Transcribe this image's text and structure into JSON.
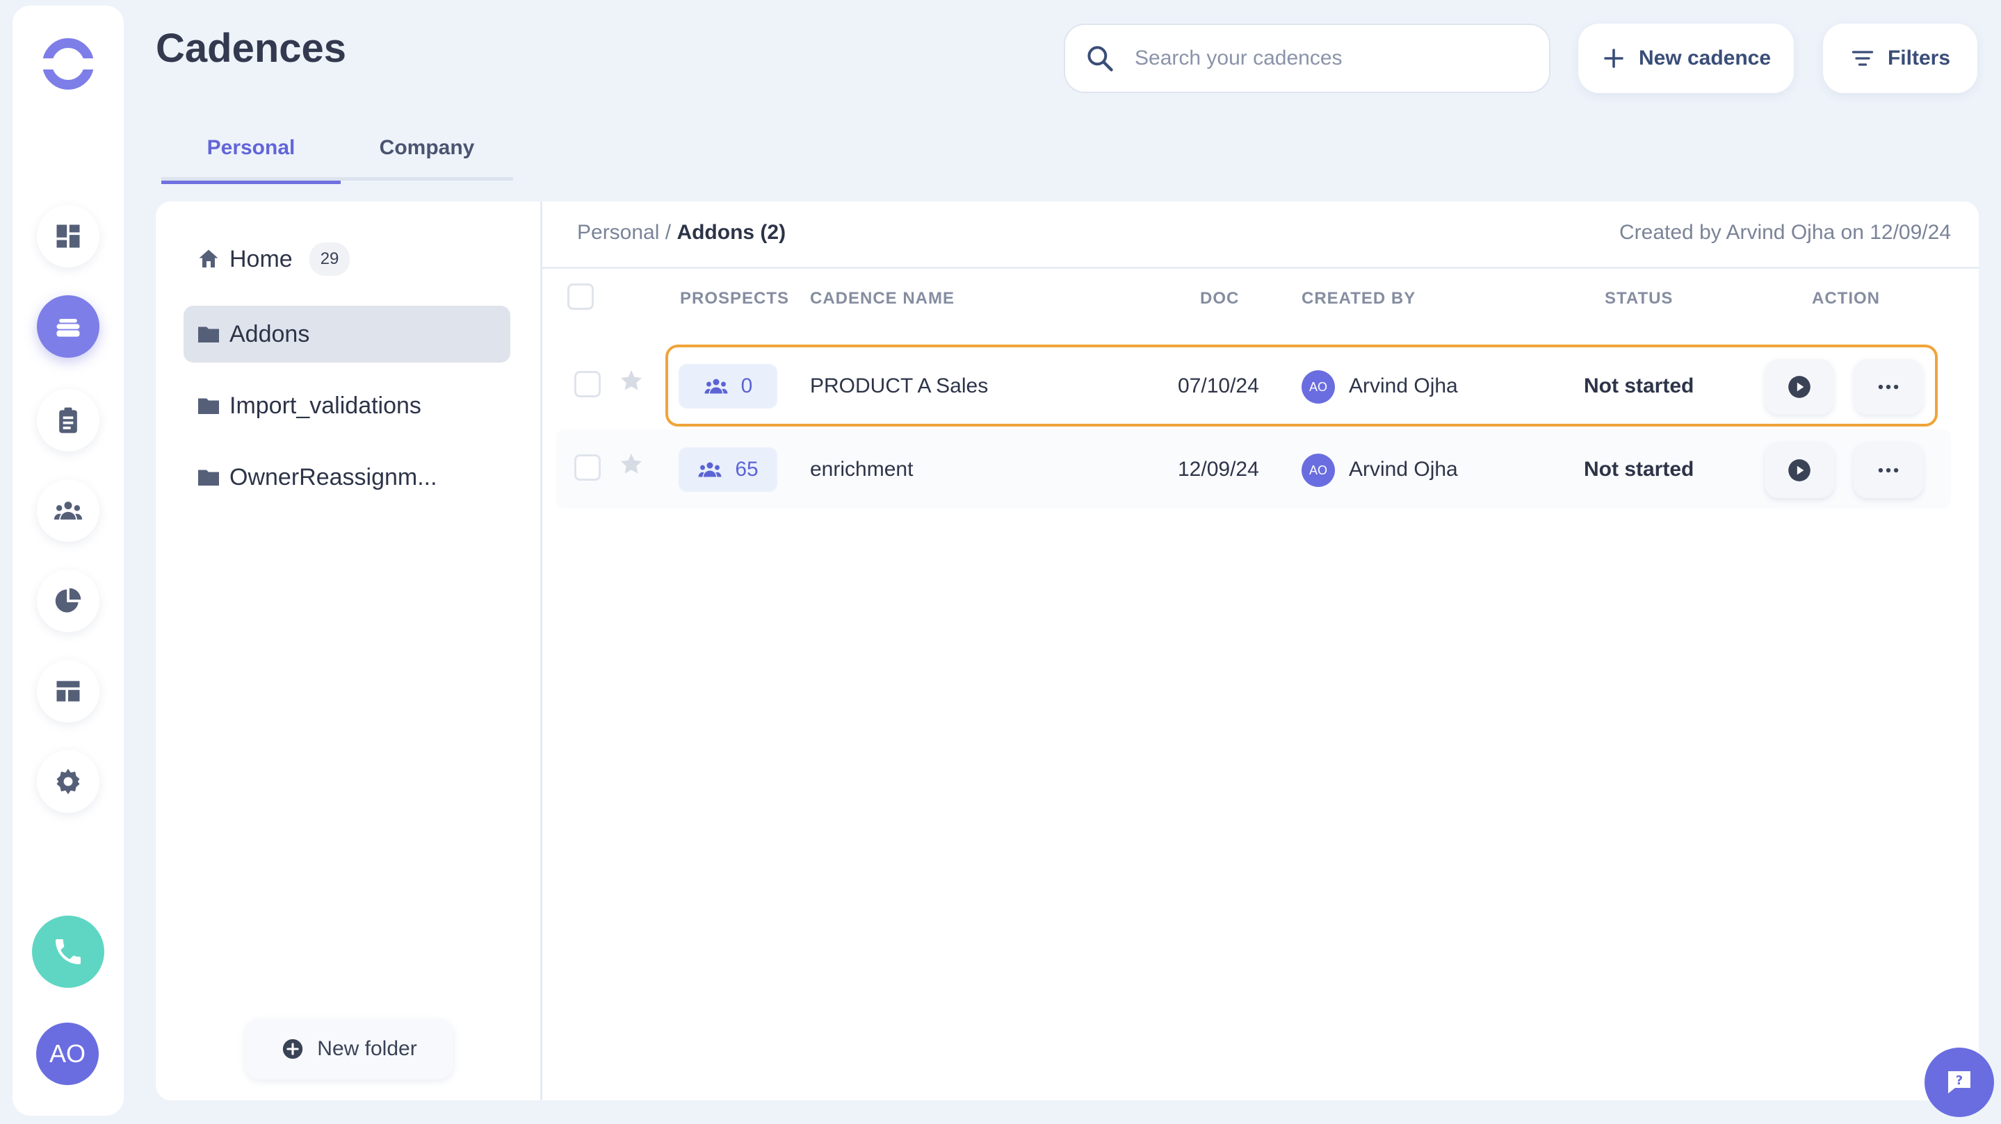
{
  "app": {
    "title": "Cadences",
    "user_initials": "AO"
  },
  "header": {
    "search_placeholder": "Search your cadences",
    "new_cadence_label": "New cadence",
    "filters_label": "Filters"
  },
  "tabs": [
    {
      "label": "Personal",
      "active": true
    },
    {
      "label": "Company",
      "active": false
    }
  ],
  "sidebar": {
    "items": [
      {
        "icon": "dashboard-icon"
      },
      {
        "icon": "cadences-icon",
        "active": true
      },
      {
        "icon": "tasks-clipboard-icon"
      },
      {
        "icon": "people-icon"
      },
      {
        "icon": "pie-chart-icon"
      },
      {
        "icon": "templates-icon"
      },
      {
        "icon": "gear-icon"
      }
    ]
  },
  "folders": {
    "home": {
      "label": "Home",
      "count": "29"
    },
    "items": [
      {
        "label": "Addons",
        "active": true
      },
      {
        "label": "Import_validations"
      },
      {
        "label": "OwnerReassignm..."
      }
    ],
    "new_folder_label": "New folder"
  },
  "list": {
    "breadcrumb_root": "Personal",
    "breadcrumb_sep": "/",
    "breadcrumb_current": "Addons (2)",
    "created_info": "Created by Arvind Ojha on 12/09/24",
    "columns": [
      "PROSPECTS",
      "CADENCE NAME",
      "DOC",
      "CREATED BY",
      "STATUS",
      "ACTION"
    ],
    "rows": [
      {
        "prospects": "0",
        "name": "PRODUCT A Sales",
        "doc": "07/10/24",
        "creator_initials": "AO",
        "creator": "Arvind Ojha",
        "status": "Not started",
        "highlighted": true
      },
      {
        "prospects": "65",
        "name": "enrichment",
        "doc": "12/09/24",
        "creator_initials": "AO",
        "creator": "Arvind Ojha",
        "status": "Not started",
        "highlighted": false
      }
    ]
  },
  "colors": {
    "accent": "#6a6de0",
    "highlight": "#f0a43a",
    "call": "#5fd6c4"
  }
}
